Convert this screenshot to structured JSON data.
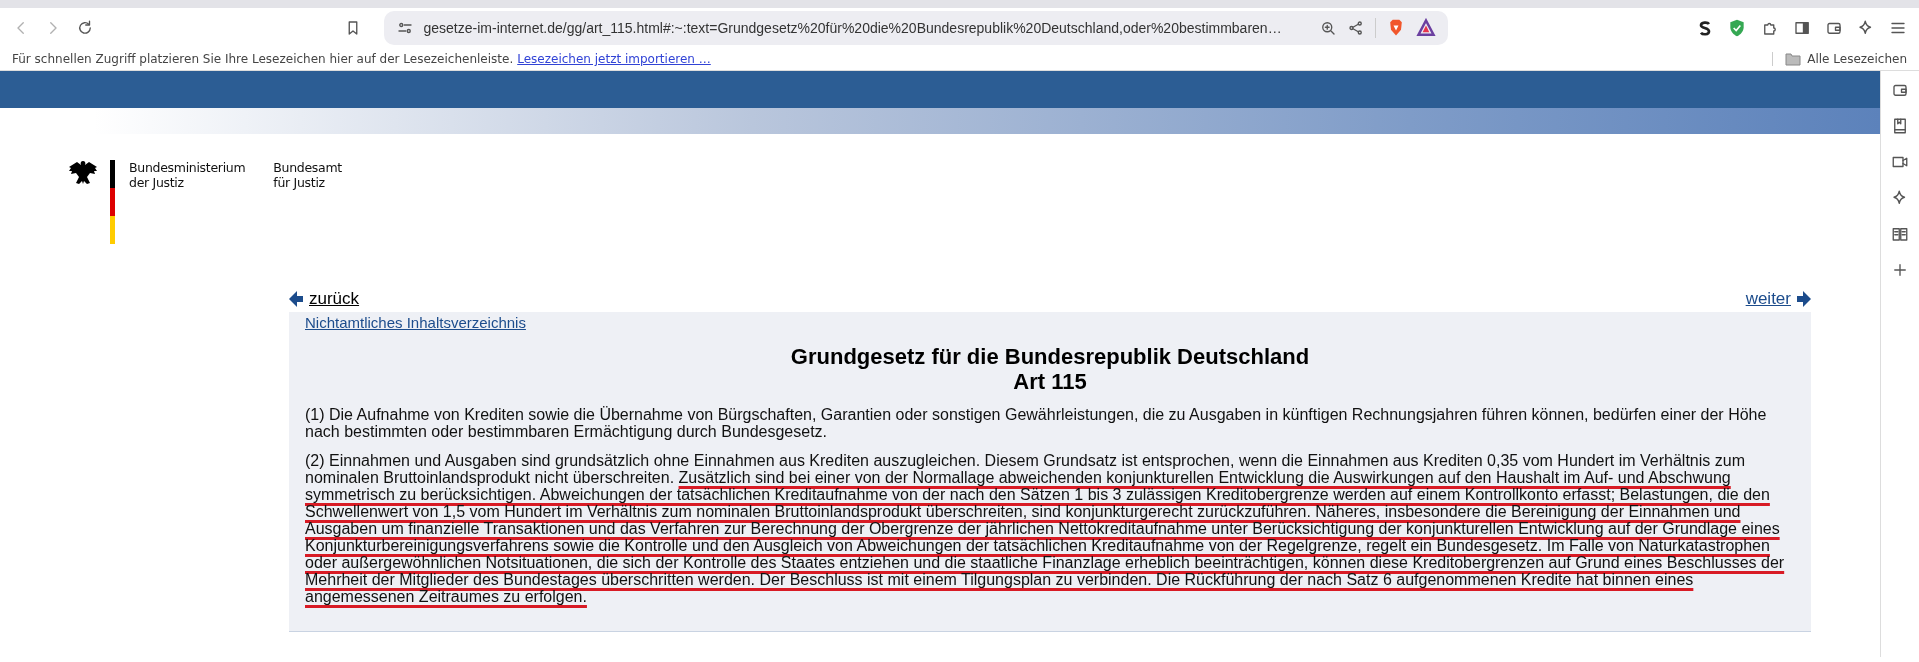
{
  "browser": {
    "url": "gesetze-im-internet.de/gg/art_115.html#:~:text=Grundgesetz%20für%20die%20Bundesrepublik%20Deutschland,oder%20bestimmbaren…",
    "bookmarks_bar": {
      "message": "Für schnellen Zugriff platzieren Sie Ihre Lesezeichen hier auf der Lesezeichenleiste.",
      "import_link": "Lesezeichen jetzt importieren …",
      "all_bookmarks": "Alle Lesezeichen"
    }
  },
  "page": {
    "logo": {
      "ministry": [
        "Bundesministerium",
        "der Justiz"
      ],
      "office": [
        "Bundesamt",
        "für Justiz"
      ]
    },
    "nav": {
      "back": "zurück",
      "forward": "weiter"
    },
    "toc_link": "Nichtamtliches Inhaltsverzeichnis",
    "title": "Grundgesetz für die Bundesrepublik Deutschland",
    "subtitle": "Art 115",
    "paragraphs": [
      {
        "text": "(1) Die Aufnahme von Krediten sowie die Übernahme von Bürgschaften, Garantien oder sonstigen Gewährleistungen, die zu Ausgaben in künftigen Rechnungsjahren führen können, bedürfen einer der Höhe nach bestimmten oder bestimmbaren Ermächtigung durch Bundesgesetz."
      },
      {
        "text": "(2) Einnahmen und Ausgaben sind grundsätzlich ohne Einnahmen aus Krediten auszugleichen. Diesem Grundsatz ist entsprochen, wenn die Einnahmen aus Krediten 0,35 vom Hundert im Verhältnis zum nominalen Bruttoinlandsprodukt nicht überschreiten.",
        "marked_text": "Zusätzlich sind bei einer von der Normallage abweichenden konjunkturellen Entwicklung die Auswirkungen auf den Haushalt im Auf- und Abschwung symmetrisch zu berücksichtigen. Abweichungen der tatsächlichen Kreditaufnahme von der nach den Sätzen 1 bis 3 zulässigen Kreditobergrenze werden auf einem Kontrollkonto erfasst; Belastungen, die den Schwellenwert von 1,5 vom Hundert im Verhältnis zum nominalen Bruttoinlandsprodukt überschreiten, sind konjunkturgerecht zurückzuführen. Näheres, insbesondere die Bereinigung der Einnahmen und Ausgaben um finanzielle Transaktionen und das Verfahren zur Berechnung der Obergrenze der jährlichen Nettokreditaufnahme unter Berücksichtigung der konjunkturellen Entwicklung auf der Grundlage eines Konjunkturbereinigungsverfahrens sowie die Kontrolle und den Ausgleich von Abweichungen der tatsächlichen Kreditaufnahme von der Regelgrenze, regelt ein Bundesgesetz. Im Falle von Naturkatastrophen oder außergewöhnlichen Notsituationen, die sich der Kontrolle des Staates entziehen und die staatliche Finanzlage erheblich beeinträchtigen, können diese Kreditobergrenzen auf Grund eines Beschlusses der Mehrheit der Mitglieder des Bundestages überschritten werden. Der Beschluss ist mit einem Tilgungsplan zu verbinden. Die Rückführung der nach Satz 6 aufgenommenen Kredite hat binnen eines angemessenen Zeitraumes zu erfolgen."
      }
    ]
  }
}
